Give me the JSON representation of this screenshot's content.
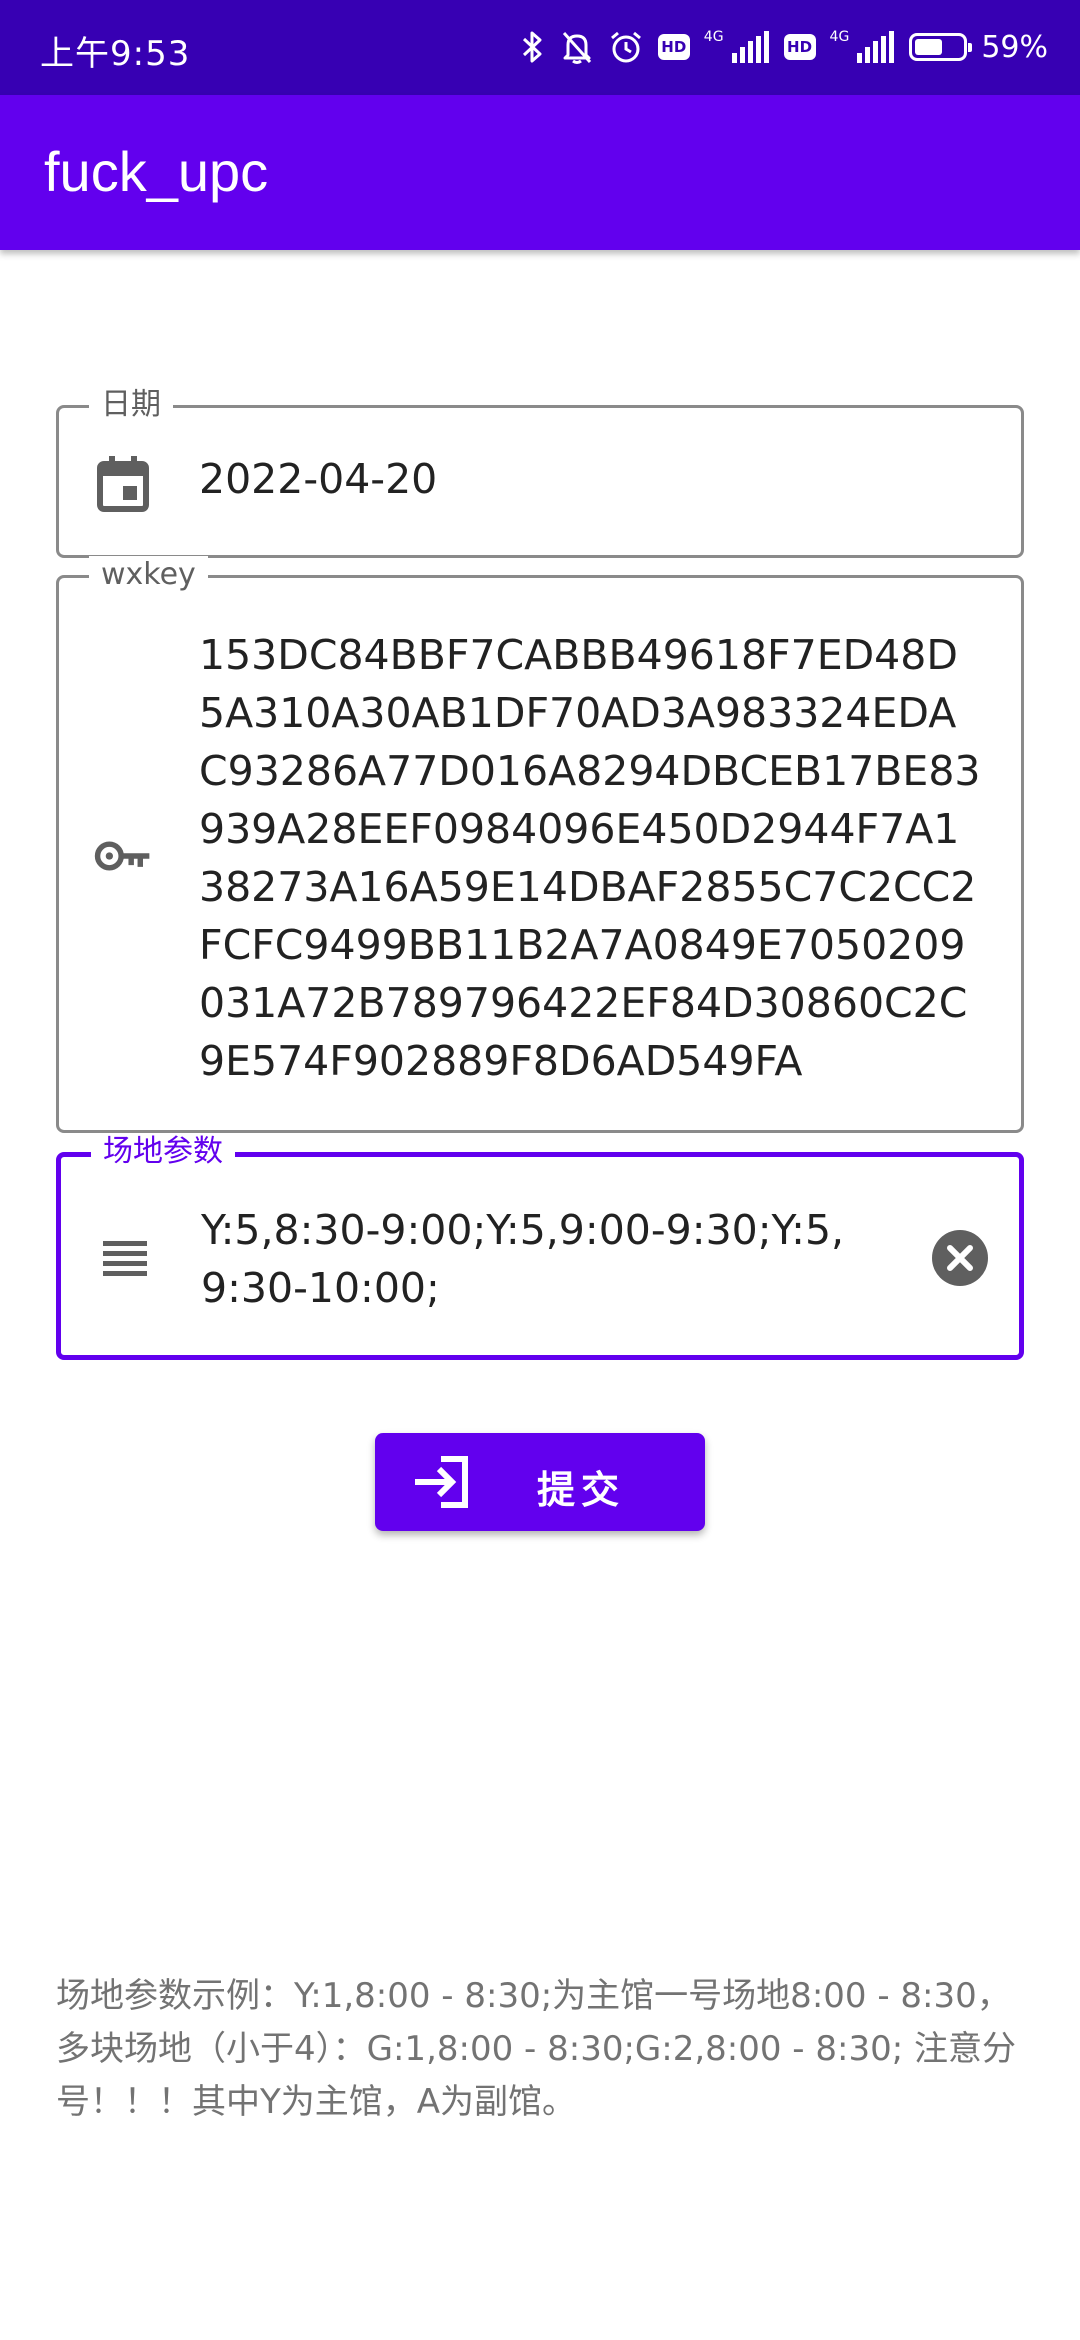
{
  "status_bar": {
    "time": "上午9:53",
    "network_1": "4G",
    "network_2": "4G",
    "battery_percent": "59%",
    "battery_level": 0.59,
    "icons": [
      "bluetooth-icon",
      "mute-bell-icon",
      "alarm-icon",
      "hd-badge",
      "signal-icon",
      "hd-badge",
      "signal-icon",
      "battery-icon"
    ]
  },
  "app_bar": {
    "title": "fuck_upc",
    "color": "#6200ee"
  },
  "date_field": {
    "label": "日期",
    "value": "2022-04-20",
    "icon": "calendar-icon"
  },
  "wxkey_field": {
    "label": "wxkey",
    "value": "153DC84BBF7CABBB49618F7ED48D5A310A30AB1DF70AD3A983324EDAC93286A77D016A8294DBCEB17BE83939A28EEF0984096E450D2944F7A138273A16A59E14DBAF2855C7C2CC2FCFC9499BB11B2A7A0849E7050209031A72B789796422EF84D30860C2C9E574F902889F8D6AD549FA",
    "icon": "key-icon"
  },
  "venue_field": {
    "label": "场地参数",
    "value": "Y:5,8:30-9:00;Y:5,9:00-9:30;Y:5,9:30-10:00;",
    "icon": "list-icon",
    "clear_icon": "clear-icon"
  },
  "submit": {
    "label": "提交",
    "icon": "login-arrow-icon"
  },
  "hint": {
    "text": "场地参数示例：Y:1,8:00 - 8:30;为主馆一号场地8:00 - 8:30，多块场地（小于4）：G:1,8:00 - 8:30;G:2,8:00 - 8:30; 注意分号！！！其中Y为主馆，A为副馆。"
  },
  "colors": {
    "status_bar": "#3700b3",
    "primary": "#6200ee",
    "outline": "#8a8a8a",
    "hint_text": "#737373"
  }
}
